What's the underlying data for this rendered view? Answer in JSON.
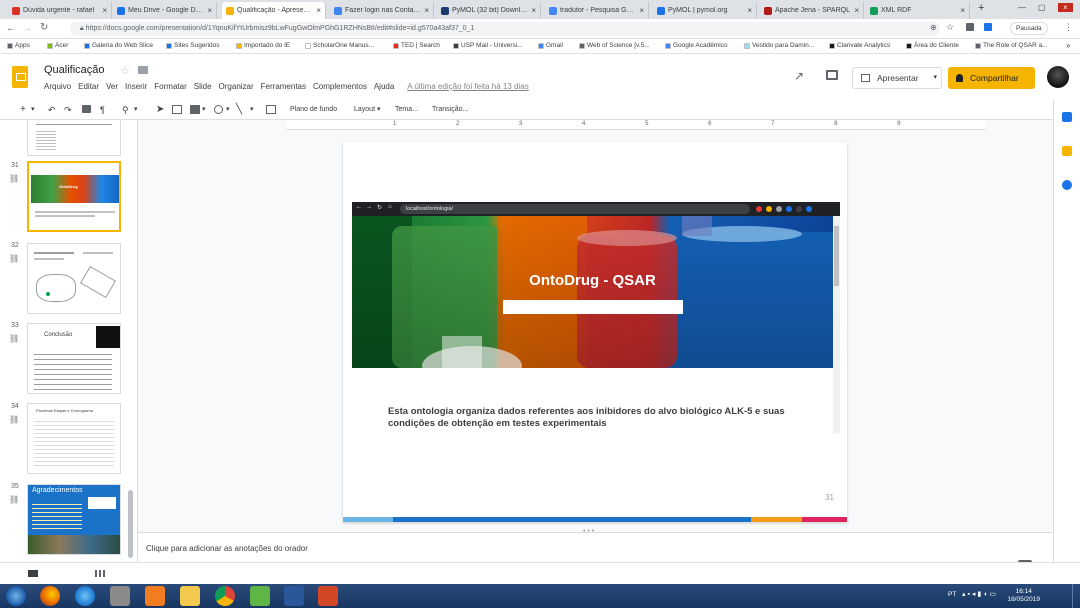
{
  "browser": {
    "tabs": [
      {
        "label": "Dúvida urgente - rafael",
        "color": "#d93025"
      },
      {
        "label": "Meu Drive - Google Drive",
        "color": "#1a73e8"
      },
      {
        "label": "Qualificação - Apresentações",
        "color": "#f4b400"
      },
      {
        "label": "Fazer login nas Contas do Google",
        "color": "#4285f4"
      },
      {
        "label": "PyMOL (32 bit) Download",
        "color": "#1a3a6b"
      },
      {
        "label": "tradutor - Pesquisa Google",
        "color": "#4285f4"
      },
      {
        "label": "PyMOL | pymol.org",
        "color": "#1a73e8"
      },
      {
        "label": "Apache Jena - SPARQL",
        "color": "#b31b1b"
      },
      {
        "label": "XML RDF",
        "color": "#0f9d58"
      }
    ],
    "new_tab": "+",
    "url": "https://docs.google.com/presentation/d/1YqnuKifYtUrbmisz9bLwFugGwOlmPGhG1RZHNsBtI/edit#slide=id.g570a43af37_0_1",
    "profile_label": "Pausada",
    "bookmarks": [
      {
        "label": "Apps",
        "color": "#5f6368"
      },
      {
        "label": "Acer",
        "color": "#83b81a"
      },
      {
        "label": "Galeria do Web Slice",
        "color": "#1a73e8"
      },
      {
        "label": "Sites Sugeridos",
        "color": "#1a73e8"
      },
      {
        "label": "Importado do IE",
        "color": "#f4b400"
      },
      {
        "label": "ScholarOne Manus...",
        "color": "#ffffff"
      },
      {
        "label": "TED | Search",
        "color": "#e62b1e"
      },
      {
        "label": "USP Mail - Universi...",
        "color": "#3c4043"
      },
      {
        "label": "Gmail",
        "color": "#4285f4"
      },
      {
        "label": "Web of Science [v.5...",
        "color": "#5f6368"
      },
      {
        "label": "Google Acadêmico",
        "color": "#4285f4"
      },
      {
        "label": "Vestido para Damin...",
        "color": "#a0d8ef"
      },
      {
        "label": "Clarivate Analytics",
        "color": "#1a1a1a"
      },
      {
        "label": "Área do Cliente",
        "color": "#1a1a1a"
      },
      {
        "label": "The Role of QSAR a...",
        "color": "#5f6368"
      }
    ]
  },
  "app": {
    "title": "Qualificação",
    "menus": [
      "Arquivo",
      "Editar",
      "Ver",
      "Inserir",
      "Formatar",
      "Slide",
      "Organizar",
      "Ferramentas",
      "Complementos",
      "Ajuda"
    ],
    "last_edit": "A última edição foi feita há 13 dias",
    "present_label": "Apresentar",
    "share_label": "Compartilhar",
    "accent": "#f4b400"
  },
  "toolbar": {
    "background_label": "Plano de fundo",
    "layout_label": "Layout",
    "theme_label": "Tema...",
    "transition_label": "Transição..."
  },
  "ruler": [
    "1",
    "2",
    "3",
    "4",
    "5",
    "6",
    "7",
    "8",
    "9"
  ],
  "filmstrip": [
    {
      "num": "31",
      "selected": true
    },
    {
      "num": "32",
      "selected": false
    },
    {
      "num": "33",
      "selected": false,
      "title": "Conclusão"
    },
    {
      "num": "34",
      "selected": false,
      "title": "Próximas Etapas e Cronograma"
    },
    {
      "num": "35",
      "selected": false,
      "title": "Agradecimentos"
    }
  ],
  "slide": {
    "screenshot_url": "localhost/ontologia/",
    "hero_title": "OntoDrug - QSAR",
    "description": "Esta ontologia organiza dados referentes aos inibidores do alvo biológico ALK-5 e suas condições de obtenção em testes experimentais",
    "number": "31",
    "stripe_colors": [
      "#6bb5e6",
      "#1a73c8",
      "#f59c1a",
      "#e0245e"
    ]
  },
  "notes": {
    "placeholder": "Clique para adicionar as anotações do orador"
  },
  "taskbar": {
    "time": "16:14",
    "date": "16/05/2019",
    "lang": "PT"
  }
}
